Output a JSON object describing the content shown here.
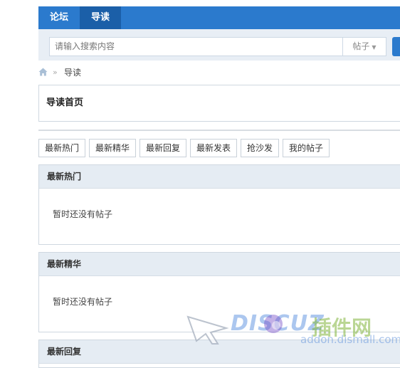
{
  "nav": {
    "items": [
      {
        "label": "论坛"
      },
      {
        "label": "导读"
      }
    ]
  },
  "search": {
    "placeholder": "请输入搜索内容",
    "type_label": "帖子"
  },
  "breadcrumb": {
    "home_icon": "home-icon",
    "current": "导读"
  },
  "page": {
    "title": "导读首页"
  },
  "tabs": [
    {
      "label": "最新热门"
    },
    {
      "label": "最新精华"
    },
    {
      "label": "最新回复"
    },
    {
      "label": "最新发表"
    },
    {
      "label": "抢沙发"
    },
    {
      "label": "我的帖子"
    }
  ],
  "sections": [
    {
      "title": "最新热门",
      "empty_text": "暂时还没有帖子"
    },
    {
      "title": "最新精华",
      "empty_text": "暂时还没有帖子"
    },
    {
      "title": "最新回复"
    }
  ],
  "watermark": {
    "brand": "DISCUZ",
    "cn": "插件网",
    "url": "addon.dismall.com"
  },
  "colors": {
    "nav_bg": "#2b7acd",
    "nav_active": "#1b5fa8",
    "section_head": "#e5ecf3"
  }
}
